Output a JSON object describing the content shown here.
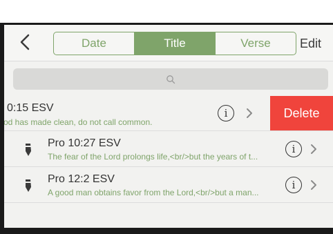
{
  "nav": {
    "segments": [
      "Date",
      "Title",
      "Verse"
    ],
    "active_segment": "Title",
    "edit_label": "Edit"
  },
  "search": {
    "placeholder": ""
  },
  "rows": [
    {
      "reference": "0:15 ESV",
      "snippet": "od has made clean, do not call common.",
      "swiped": true
    },
    {
      "reference": "Pro 10:27 ESV",
      "snippet": "The fear of the Lord prolongs life,<br/>but the years of t..."
    },
    {
      "reference": "Pro 12:2 ESV",
      "snippet": "A good man obtains favor from the Lord,<br/>but a man..."
    }
  ],
  "delete_label": "Delete",
  "colors": {
    "accent": "#7fa46a",
    "delete": "#f0443c"
  },
  "icons": {
    "back": "chevron-left-icon",
    "search": "magnifier-icon",
    "info": "info-circle-icon",
    "disclosure": "chevron-right-icon",
    "note": "pen-icon"
  }
}
